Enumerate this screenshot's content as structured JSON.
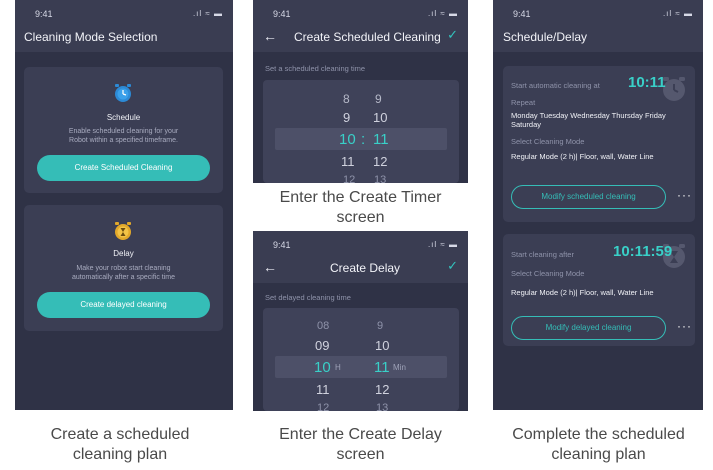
{
  "status": {
    "time": "9:41",
    "signal": ".ıl ≈ ▬"
  },
  "screen1": {
    "title": "Cleaning Mode Selection",
    "schedule": {
      "title": "Schedule",
      "desc": "Enable scheduled cleaning for your Robot within a specified timeframe.",
      "button": "Create Scheduled Cleaning"
    },
    "delay": {
      "title": "Delay",
      "desc": "Make your robot start cleaning automatically after a specific time",
      "button": "Create delayed cleaning"
    }
  },
  "screen2": {
    "title": "Create Scheduled Cleaning",
    "hint": "Set a scheduled cleaning time",
    "picker": {
      "rows": [
        {
          "h": "8",
          "m": "9"
        },
        {
          "h": "9",
          "m": "10"
        },
        {
          "h": "10",
          "sep": ":",
          "m": "11"
        },
        {
          "h": "11",
          "m": "12"
        },
        {
          "h": "12",
          "m": "13"
        }
      ]
    }
  },
  "screen3": {
    "title": "Create Delay",
    "hint": "Set delayed cleaning time",
    "picker": {
      "rows": [
        {
          "h": "08",
          "m": "9"
        },
        {
          "h": "09",
          "m": "10"
        },
        {
          "h": "10",
          "hu": "H",
          "m": "11",
          "mu": "Min"
        },
        {
          "h": "11",
          "m": "12"
        },
        {
          "h": "12",
          "m": "13"
        }
      ]
    }
  },
  "screen4": {
    "title": "Schedule/Delay",
    "scheduled": {
      "start_label": "Start automatic cleaning at",
      "time": "10:11",
      "repeat_label": "Repeat",
      "repeat_days": "Monday  Tuesday  Wednesday  Thursday  Friday  Saturday",
      "mode_label": "Select Cleaning Mode",
      "mode": "Regular Mode (2 h)| Floor, wall, Water Line",
      "button": "Modify scheduled cleaning",
      "more": "···"
    },
    "delayed": {
      "start_label": "Start cleaning after",
      "time": "10:11:59",
      "mode_label": "Select Cleaning Mode",
      "mode": "Regular Mode (2 h)| Floor, wall, Water Line",
      "button": "Modify delayed cleaning",
      "more": "···"
    }
  },
  "captions": {
    "c1": "Create a scheduled cleaning plan",
    "c2": "Enter the Create Timer screen",
    "c3": "Enter the Create Delay screen",
    "c4": "Complete the scheduled cleaning plan"
  }
}
